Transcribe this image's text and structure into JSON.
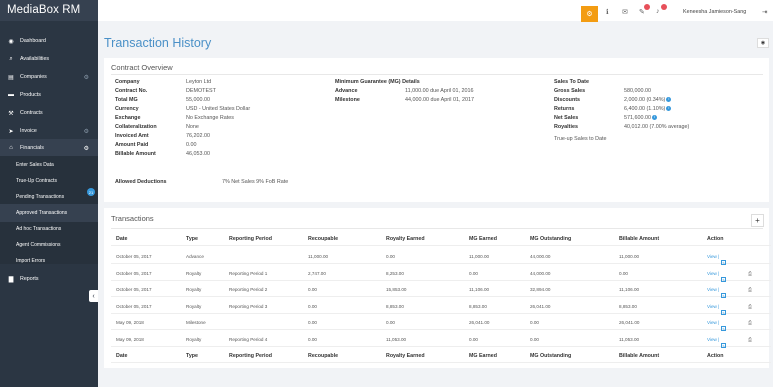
{
  "app": {
    "title": "MediaBox RM"
  },
  "sidebar": {
    "items": [
      {
        "label": "Dashboard",
        "icon": "dashboard-icon",
        "glyph": "◉"
      },
      {
        "label": "Availabilities",
        "icon": "search-icon",
        "glyph": "⌕"
      },
      {
        "label": "Companies",
        "icon": "building-icon",
        "glyph": "▤"
      },
      {
        "label": "Products",
        "icon": "film-icon",
        "glyph": "▬"
      },
      {
        "label": "Contracts",
        "icon": "wrench-icon",
        "glyph": "⚒"
      },
      {
        "label": "Invoice",
        "icon": "send-icon",
        "glyph": "➤"
      },
      {
        "label": "Financials",
        "icon": "bank-icon",
        "glyph": "⌂"
      }
    ],
    "financials_sub": [
      {
        "label": "Enter Sales Data"
      },
      {
        "label": "True-Up Contracts"
      },
      {
        "label": "Pending Transactions",
        "badge": "21"
      },
      {
        "label": "Approved Transactions"
      },
      {
        "label": "Ad hoc Transactions"
      },
      {
        "label": "Agent Commissions"
      },
      {
        "label": "Import Errors"
      }
    ],
    "reports": {
      "label": "Reports",
      "icon": "chart-icon",
      "glyph": "▇"
    },
    "gear_glyph": "⚙",
    "collapse_glyph": "‹"
  },
  "topbar": {
    "settings_glyph": "⚙",
    "info_glyph": "ℹ",
    "mail_glyph": "✉",
    "note_glyph": "✎",
    "bell_glyph": "♪",
    "user_name": "Keneesha Jamieson-Sang",
    "logout_glyph": "⇥"
  },
  "page": {
    "title": "Transaction History",
    "eye_glyph": "◉"
  },
  "contract_overview": {
    "title": "Contract Overview",
    "left": [
      {
        "k": "Company",
        "v": "Leyton Ltd",
        "link": false
      },
      {
        "k": "Contract No.",
        "v": "DEMOTEST",
        "link": true
      },
      {
        "k": "Total MG",
        "v": "55,000.00",
        "link": false
      },
      {
        "k": "Currency",
        "v": "USD - United States Dollar",
        "link": false
      },
      {
        "k": "Exchange",
        "v": "No Exchange Rates",
        "link": false
      },
      {
        "k": "Collateralization",
        "v": "None",
        "link": false
      },
      {
        "k": "Invoiced Amt",
        "v": "76,202.00",
        "link": false
      },
      {
        "k": "Amount Paid",
        "v": "0.00",
        "link": false
      },
      {
        "k": "Billable Amount",
        "v": "46,053.00",
        "link": false
      }
    ],
    "mg_title": "Minimum Guarantee (MG) Details",
    "mg": [
      {
        "k": "Advance",
        "v": "11,000.00 due April 01, 2016"
      },
      {
        "k": "Milestone",
        "v": "44,000.00 due April 01, 2017"
      }
    ],
    "sales_title": "Sales To Date",
    "sales": [
      {
        "k": "Gross Sales",
        "v": "580,000.00",
        "info": false
      },
      {
        "k": "Discounts",
        "v": "2,000.00 (0.34%)",
        "info": true
      },
      {
        "k": "Returns",
        "v": "6,400.00 (1.10%)",
        "info": true
      },
      {
        "k": "Net Sales",
        "v": "571,600.00",
        "info": true
      },
      {
        "k": "Royalties",
        "v": "40,012.00 (7.00% average)",
        "info": false
      }
    ],
    "trueup_link": "True-up Sales to Date",
    "deductions_label": "Allowed Deductions",
    "deductions_value": "7% Net Sales 9% FoB Rate",
    "info_glyph": "i"
  },
  "transactions": {
    "title": "Transactions",
    "add_glyph": "+",
    "columns": [
      "Date",
      "Type",
      "Reporting Period",
      "Recoupable",
      "Royalty Earned",
      "MG Earned",
      "MG Outstanding",
      "Billable Amount",
      "Action"
    ],
    "rows": [
      [
        "October 05, 2017",
        "Advance",
        "",
        "11,000.00",
        "0.00",
        "11,000.00",
        "44,000.00",
        "11,000.00"
      ],
      [
        "October 05, 2017",
        "Royalty",
        "Reporting Period 1",
        "2,747.00",
        "8,253.00",
        "0.00",
        "44,000.00",
        "0.00"
      ],
      [
        "October 05, 2017",
        "Royalty",
        "Reporting Period 2",
        "0.00",
        "15,853.00",
        "11,106.00",
        "32,894.00",
        "11,106.00"
      ],
      [
        "October 05, 2017",
        "Royalty",
        "Reporting Period 3",
        "0.00",
        "8,853.00",
        "8,853.00",
        "26,041.00",
        "8,853.00"
      ],
      [
        "May 09, 2018",
        "Milestone",
        "",
        "0.00",
        "0.00",
        "26,041.00",
        "0.00",
        "26,041.00"
      ],
      [
        "May 09, 2018",
        "Royalty",
        "Reporting Period 4",
        "0.00",
        "11,053.00",
        "0.00",
        "0.00",
        "11,053.00"
      ]
    ],
    "view_label": "View |",
    "edit_glyph": "✎",
    "doc_glyph": "⎙"
  }
}
